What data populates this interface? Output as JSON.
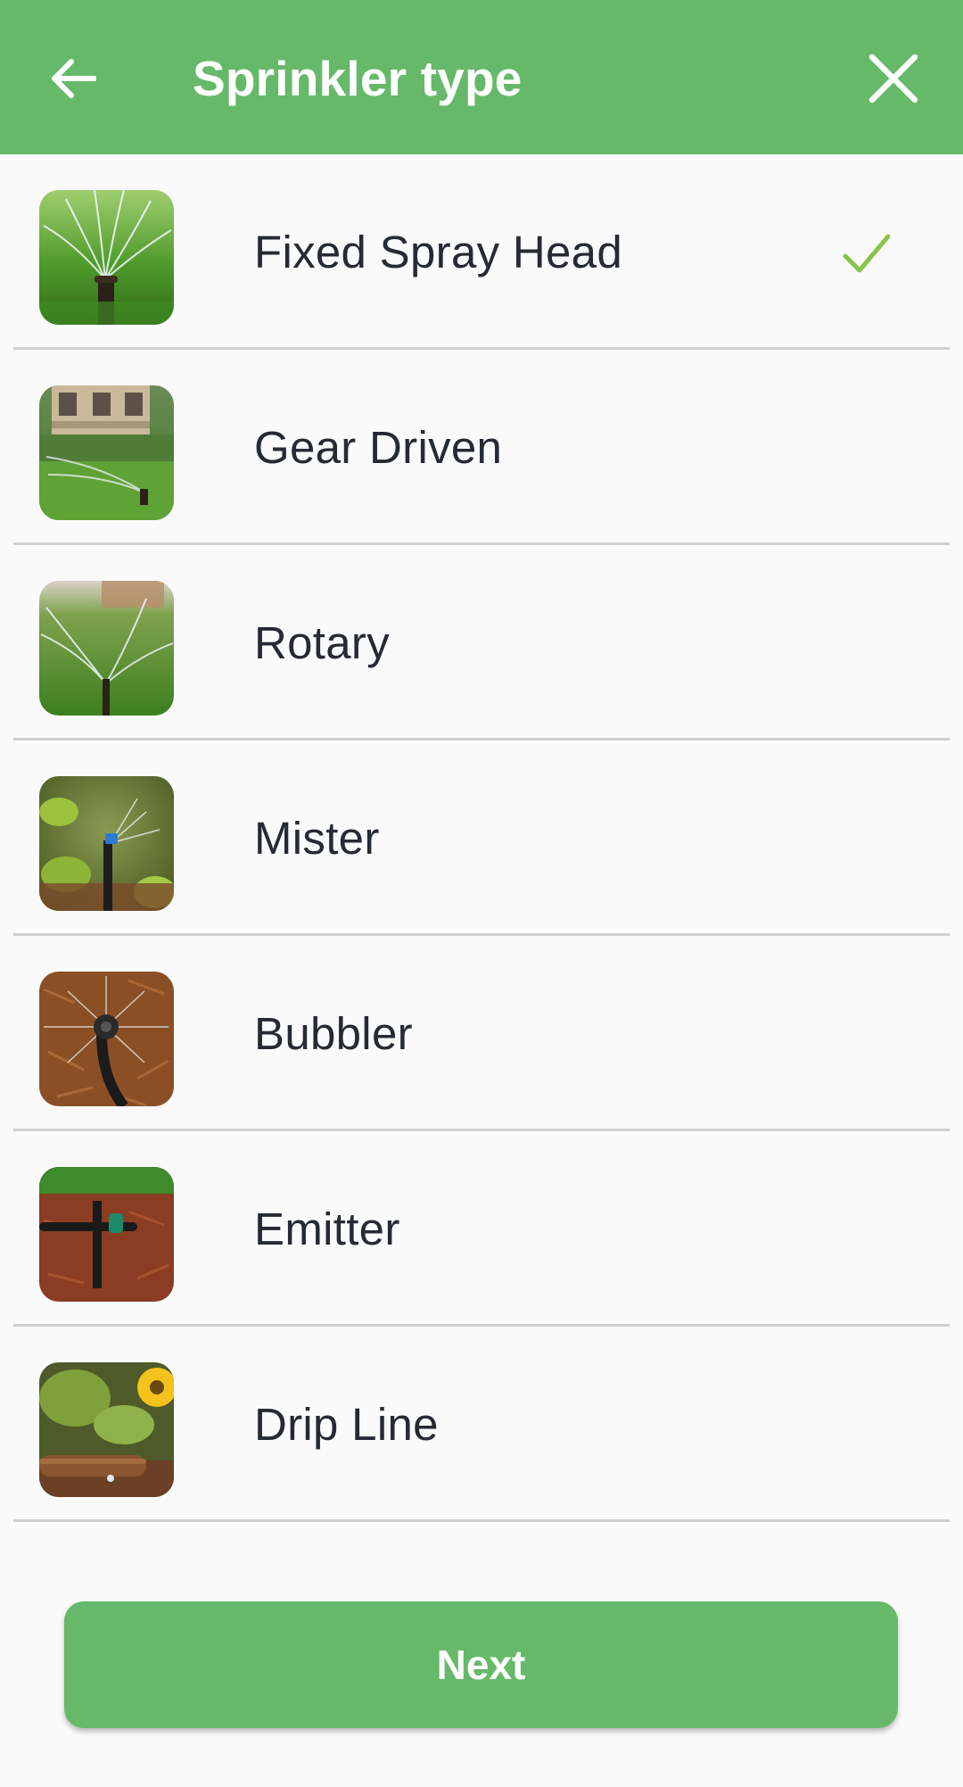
{
  "header": {
    "title": "Sprinkler type",
    "back_icon": "arrow-left-icon",
    "close_icon": "close-icon"
  },
  "sprinkler_types": [
    {
      "label": "Fixed Spray Head",
      "image": "fixed-spray-head-photo",
      "selected": true
    },
    {
      "label": "Gear Driven",
      "image": "gear-driven-photo",
      "selected": false
    },
    {
      "label": "Rotary",
      "image": "rotary-photo",
      "selected": false
    },
    {
      "label": "Mister",
      "image": "mister-photo",
      "selected": false
    },
    {
      "label": "Bubbler",
      "image": "bubbler-photo",
      "selected": false
    },
    {
      "label": "Emitter",
      "image": "emitter-photo",
      "selected": false
    },
    {
      "label": "Drip Line",
      "image": "drip-line-photo",
      "selected": false
    }
  ],
  "footer": {
    "next_label": "Next"
  },
  "colors": {
    "primary": "#66b969",
    "check": "#8bc34a",
    "text": "#262a33",
    "background": "#fafafa",
    "divider": "#cfcfcf"
  }
}
